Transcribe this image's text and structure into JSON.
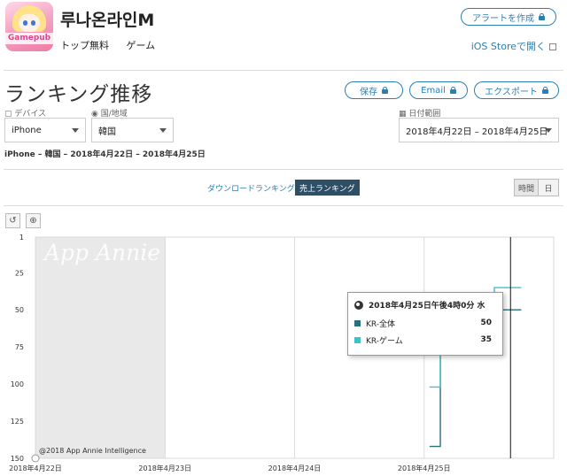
{
  "app": {
    "name": "루나온라인M",
    "category_1": "トップ無料",
    "category_2": "ゲーム",
    "icon_badge_text": "Gamepub",
    "icon": "app-icon-anime-girl"
  },
  "header": {
    "alert_button": "アラートを作成",
    "ios_store_link": "iOS Storeで開く"
  },
  "page": {
    "title": "ランキング推移",
    "save_button": "保存",
    "email_button": "Email",
    "export_button": "エクスポート"
  },
  "filters": {
    "device_label": "デバイス",
    "device_value": "iPhone",
    "country_label": "国/地域",
    "country_value": "韓国",
    "date_label": "日付範囲",
    "date_value": "2018年4月22日 – 2018年4月25日"
  },
  "subtitle": "iPhone – 韓国 – 2018年4月22日 – 2018年4月25日",
  "ranking_toggle": {
    "download_label": "ダウンロードランキング",
    "revenue_label": "売上ランキング",
    "selected": "売上ランキング"
  },
  "granularity": {
    "hourly": "時間",
    "daily": "日"
  },
  "tools": {
    "reset_icon": "undo-icon",
    "zoom_icon": "zoom-in-icon"
  },
  "tooltip": {
    "datetime": "2018年4月25日午後4時0分 水",
    "rows": [
      {
        "name": "KR-全体",
        "value": "50",
        "color": "#2a6f7a"
      },
      {
        "name": "KR-ゲーム",
        "value": "35",
        "color": "#3cc3c9"
      }
    ]
  },
  "watermark": "App Annie",
  "copyright": "@2018 App Annie Intelligence",
  "chart_data": {
    "type": "line",
    "y_axis": {
      "reversed": true,
      "ylim": [
        1,
        150
      ],
      "ticks": [
        "1",
        "25",
        "50",
        "75",
        "100",
        "125",
        "150"
      ]
    },
    "x_axis": {
      "ticks": [
        "2018年4月22日",
        "2018年4月23日",
        "2018年4月24日",
        "2018年4月25日"
      ]
    },
    "grid": true,
    "series": [
      {
        "name": "KR-全体",
        "color": "#2a6f7a",
        "points": [
          {
            "t": "2018-04-25 01:00",
            "rank": 142
          },
          {
            "t": "2018-04-25 02:00",
            "rank": 142
          },
          {
            "t": "2018-04-25 03:00",
            "rank": 59
          },
          {
            "t": "2018-04-25 12:00",
            "rank": 59
          },
          {
            "t": "2018-04-25 13:00",
            "rank": 50
          },
          {
            "t": "2018-04-25 18:00",
            "rank": 50
          }
        ]
      },
      {
        "name": "KR-ゲーム",
        "color": "#3cc3c9",
        "points": [
          {
            "t": "2018-04-25 01:00",
            "rank": 102
          },
          {
            "t": "2018-04-25 02:00",
            "rank": 102
          },
          {
            "t": "2018-04-25 03:00",
            "rank": 43
          },
          {
            "t": "2018-04-25 07:00",
            "rank": 43
          },
          {
            "t": "2018-04-25 08:00",
            "rank": 57
          },
          {
            "t": "2018-04-25 11:00",
            "rank": 57
          },
          {
            "t": "2018-04-25 12:00",
            "rank": 43
          },
          {
            "t": "2018-04-25 13:00",
            "rank": 35
          },
          {
            "t": "2018-04-25 18:00",
            "rank": 35
          }
        ]
      }
    ],
    "selected_time": "2018-04-25 16:00"
  }
}
